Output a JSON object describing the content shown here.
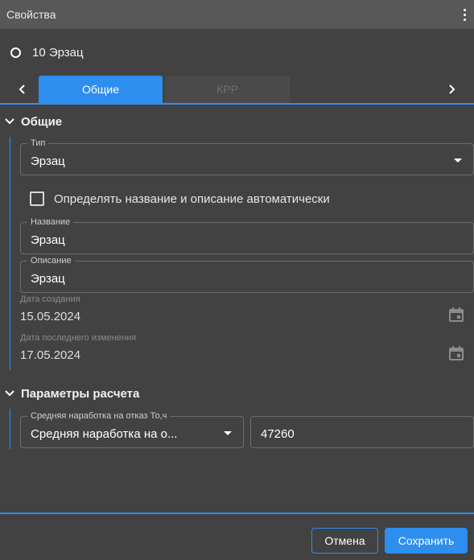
{
  "panel": {
    "title": "Свойства",
    "menu_icon": "more-vert-icon"
  },
  "object": {
    "name": "10 Эрзац",
    "icon": "circle-outline-icon"
  },
  "tabs": {
    "prev_icon": "chevron-left-icon",
    "next_icon": "chevron-right-icon",
    "items": [
      {
        "label": "Общие",
        "active": true
      },
      {
        "label": "КРР",
        "active": false
      }
    ]
  },
  "general": {
    "title": "Общие",
    "type_field": {
      "label": "Тип",
      "value": "Эрзац"
    },
    "auto_name_checkbox": {
      "label": "Определять название и описание автоматически",
      "checked": false
    },
    "name_field": {
      "label": "Название",
      "value": "Эрзац"
    },
    "description_field": {
      "label": "Описание",
      "value": "Эрзац"
    },
    "created": {
      "label": "Дата создания",
      "value": "15.05.2024"
    },
    "modified": {
      "label": "Дата последнего изменения",
      "value": "17.05.2024"
    }
  },
  "calc_params": {
    "title": "Параметры расчета",
    "mtbf_select": {
      "label": "Средняя наработка на отказ То,ч",
      "value": "Средняя наработка на о..."
    },
    "mtbf_value": "47260"
  },
  "footer": {
    "cancel_label": "Отмена",
    "save_label": "Сохранить"
  },
  "colors": {
    "accent": "#2d8eee",
    "background": "#424242",
    "titlebar": "#585858"
  }
}
